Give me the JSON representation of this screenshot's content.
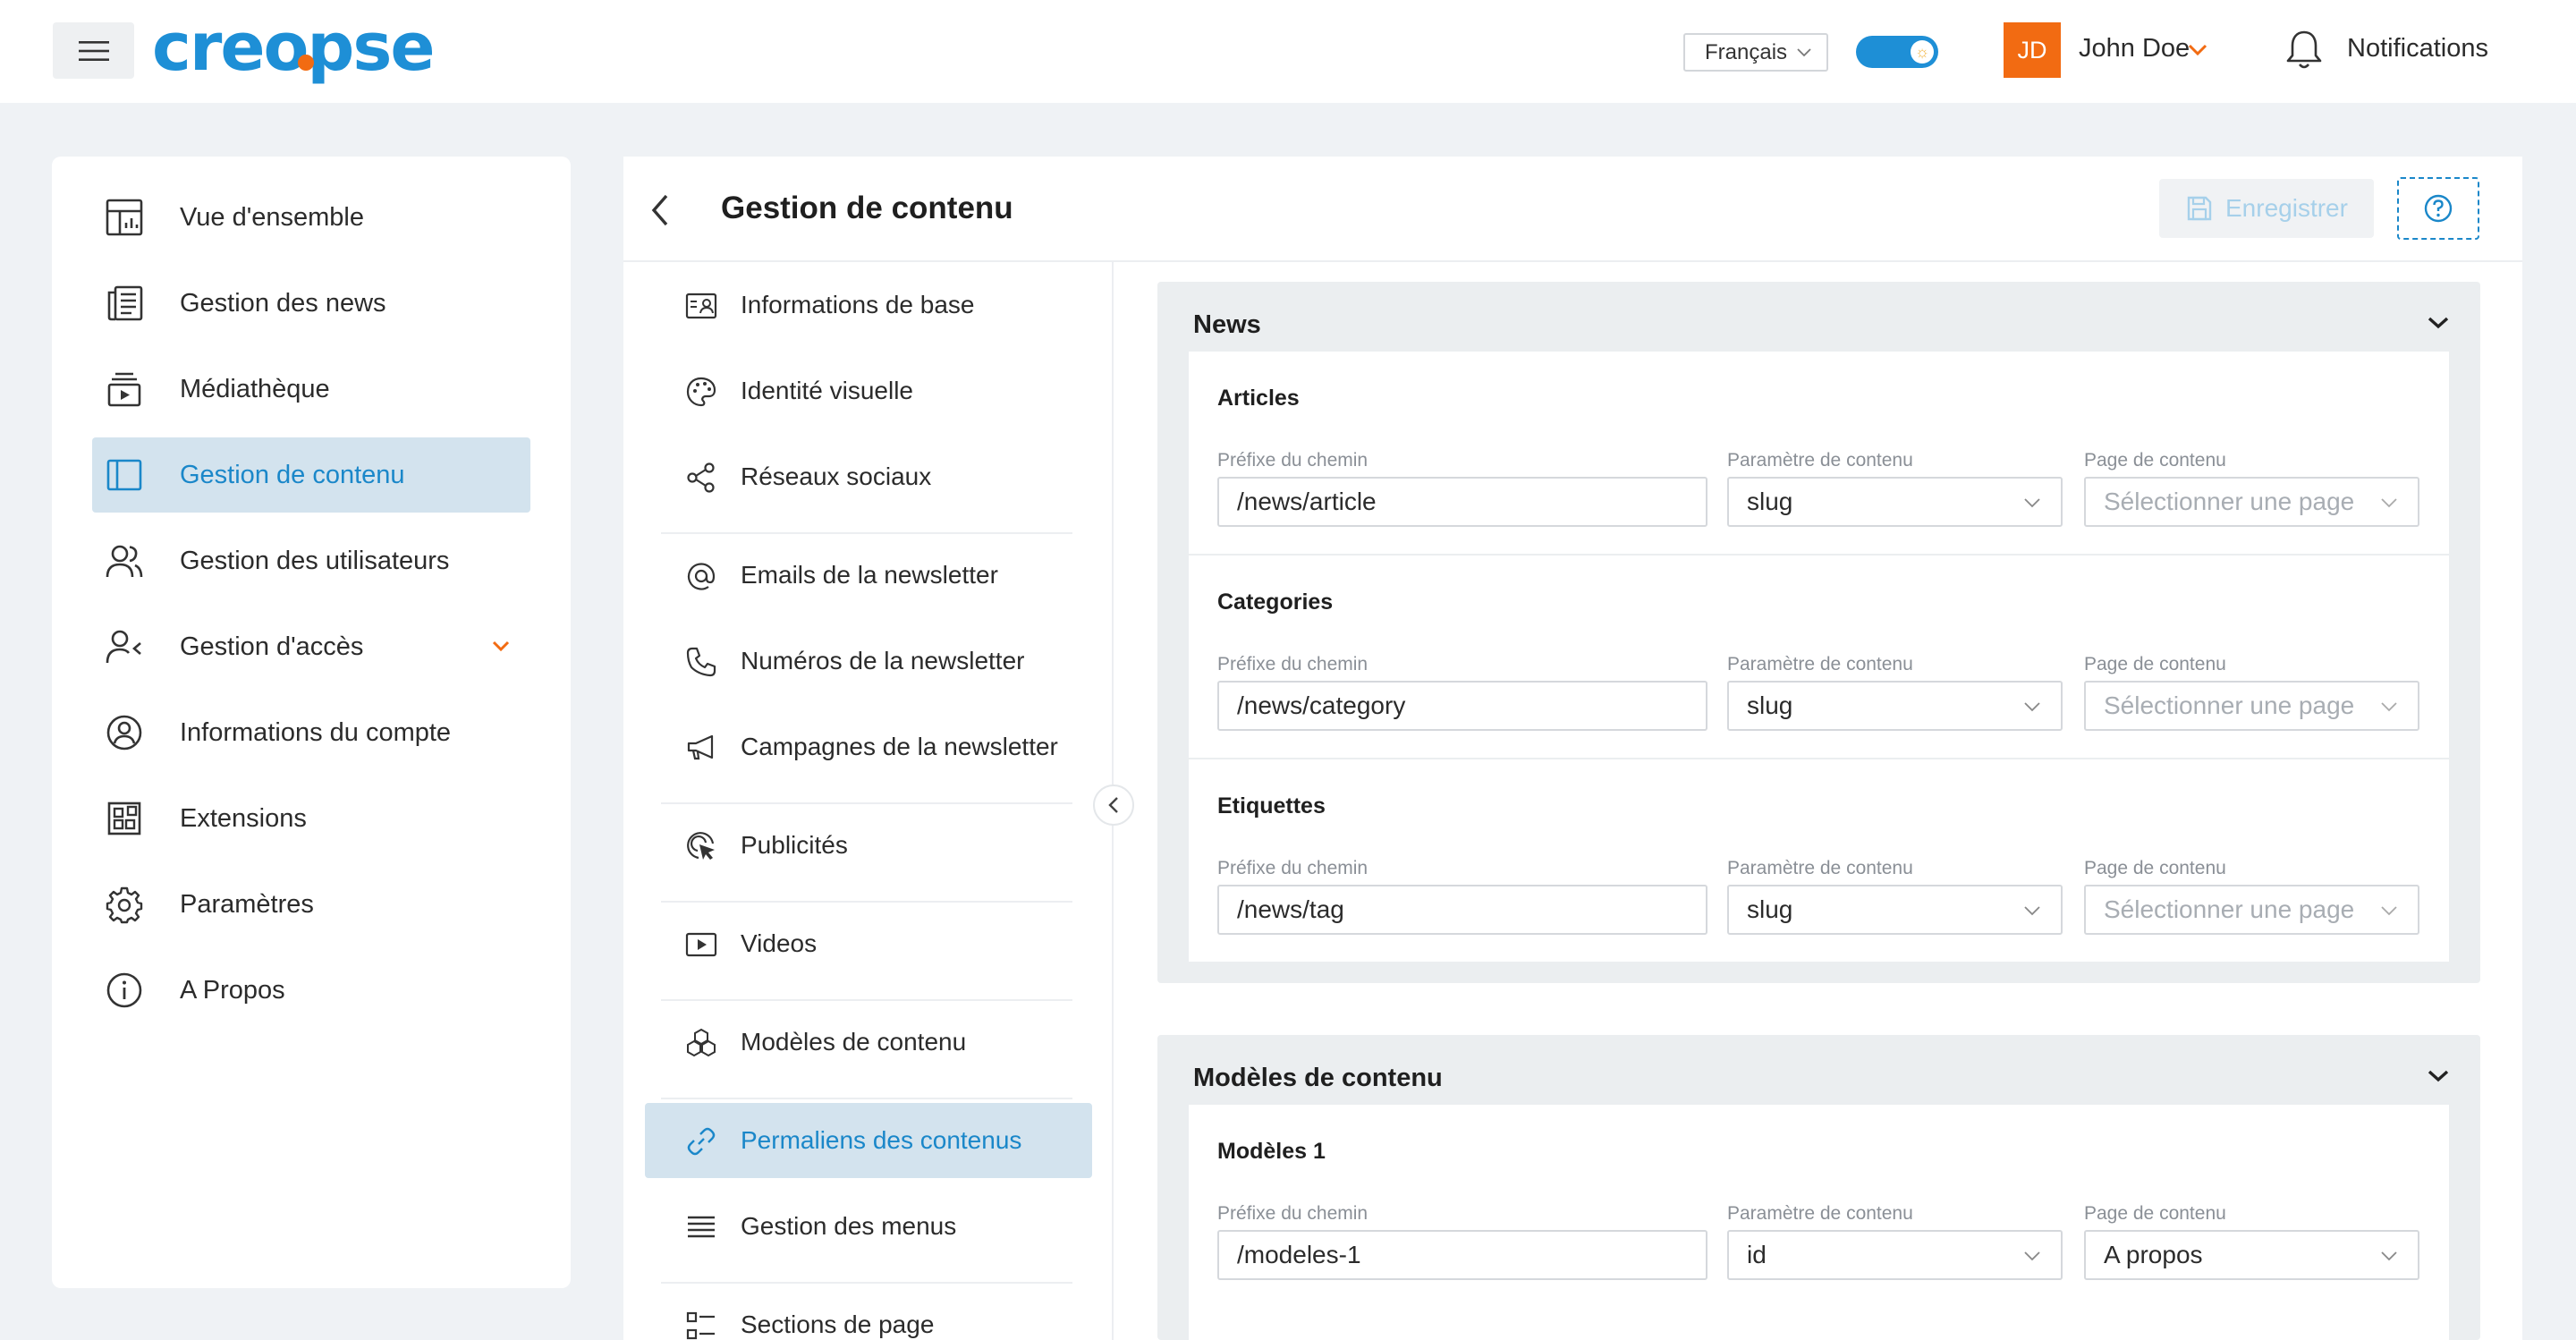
{
  "header": {
    "brand": "creopse",
    "language": "Français",
    "user_initials": "JD",
    "user_name": "John Doe",
    "notifications_label": "Notifications",
    "colors": {
      "brand": "#1e8fd6",
      "accent": "#f26b12"
    }
  },
  "sidebar": {
    "items": [
      {
        "label": "Vue d'ensemble",
        "icon": "dashboard-icon"
      },
      {
        "label": "Gestion des news",
        "icon": "newspaper-icon"
      },
      {
        "label": "Médiathèque",
        "icon": "media-library-icon"
      },
      {
        "label": "Gestion de contenu",
        "icon": "layout-panel-icon",
        "active": true
      },
      {
        "label": "Gestion des utilisateurs",
        "icon": "users-icon"
      },
      {
        "label": "Gestion d'accès",
        "icon": "user-access-icon",
        "expandable": true
      },
      {
        "label": "Informations du compte",
        "icon": "account-circle-icon"
      },
      {
        "label": "Extensions",
        "icon": "extensions-icon"
      },
      {
        "label": "Paramètres",
        "icon": "gear-icon"
      },
      {
        "label": "A Propos",
        "icon": "info-icon"
      }
    ]
  },
  "page": {
    "title": "Gestion de contenu",
    "save_label": "Enregistrer"
  },
  "submenu": {
    "items": [
      {
        "label": "Informations de base",
        "icon": "id-card-icon"
      },
      {
        "label": "Identité visuelle",
        "icon": "palette-icon"
      },
      {
        "label": "Réseaux sociaux",
        "icon": "share-icon"
      },
      {
        "label": "Emails de la newsletter",
        "icon": "at-sign-icon"
      },
      {
        "label": "Numéros de la newsletter",
        "icon": "phone-icon"
      },
      {
        "label": "Campagnes de la newsletter",
        "icon": "megaphone-icon"
      },
      {
        "label": "Publicités",
        "icon": "ad-click-icon"
      },
      {
        "label": "Videos",
        "icon": "video-icon"
      },
      {
        "label": "Modèles de contenu",
        "icon": "blocks-icon"
      },
      {
        "label": "Permaliens des contenus",
        "icon": "link-icon",
        "active": true
      },
      {
        "label": "Gestion des menus",
        "icon": "menu-lines-icon"
      },
      {
        "label": "Sections de page",
        "icon": "sections-icon"
      }
    ]
  },
  "fields": {
    "prefix_label": "Préfixe du chemin",
    "param_label": "Paramètre de contenu",
    "page_label": "Page de contenu",
    "page_placeholder": "Sélectionner une page"
  },
  "sections": [
    {
      "title": "News",
      "cards": [
        {
          "title": "Articles",
          "prefix": "/news/article",
          "param": "slug",
          "page": ""
        },
        {
          "title": "Categories",
          "prefix": "/news/category",
          "param": "slug",
          "page": ""
        },
        {
          "title": "Etiquettes",
          "prefix": "/news/tag",
          "param": "slug",
          "page": ""
        }
      ]
    },
    {
      "title": "Modèles de contenu",
      "cards": [
        {
          "title": "Modèles 1",
          "prefix": "/modeles-1",
          "param": "id",
          "page": "A propos"
        }
      ]
    }
  ]
}
